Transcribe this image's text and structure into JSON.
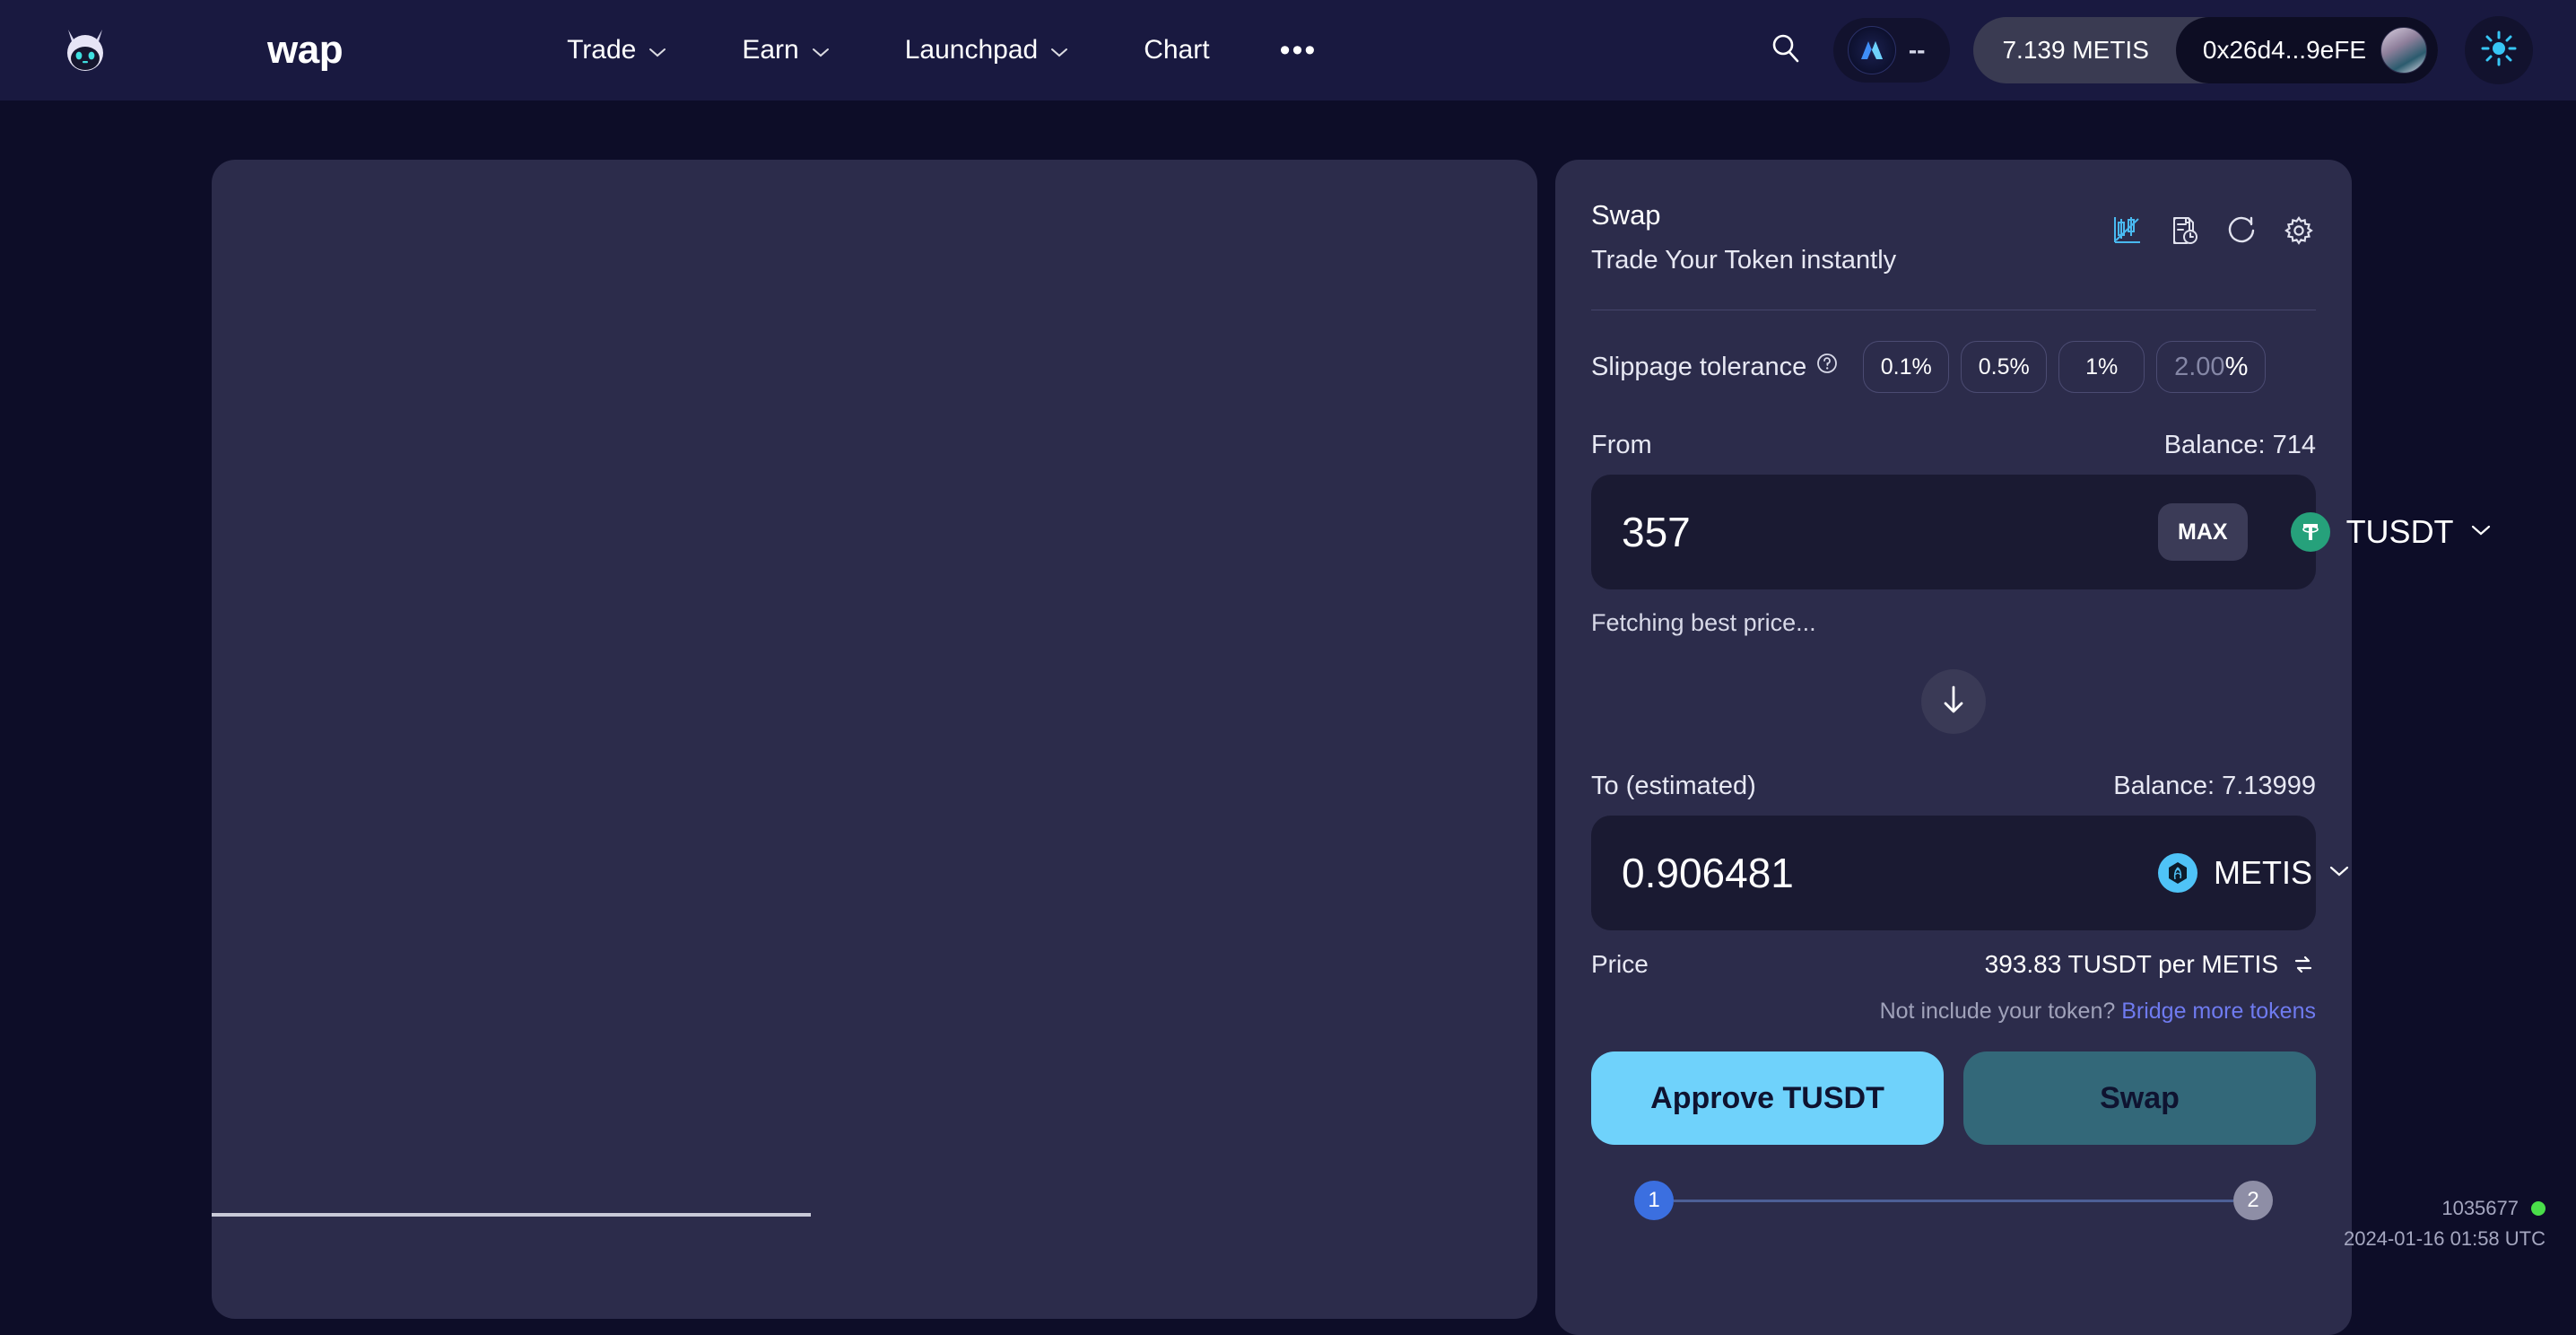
{
  "header": {
    "brand_wordmark": "wap",
    "brand_icon": "cat-head-logo",
    "nav": [
      {
        "label": "Trade",
        "has_dropdown": true
      },
      {
        "label": "Earn",
        "has_dropdown": true
      },
      {
        "label": "Launchpad",
        "has_dropdown": true
      },
      {
        "label": "Chart",
        "has_dropdown": false
      }
    ],
    "more_label": "•••",
    "search_icon": "search-icon",
    "network_value": "--",
    "network_icon": "metis-network-icon",
    "wallet_balance": "7.139 METIS",
    "wallet_address": "0x26d4...9eFE",
    "theme_icon": "sun-icon"
  },
  "swap": {
    "title": "Swap",
    "subtitle": "Trade Your Token instantly",
    "icons": [
      {
        "name": "chart-icon",
        "active": true
      },
      {
        "name": "document-clock-icon",
        "active": false
      },
      {
        "name": "history-clock-icon",
        "active": false
      },
      {
        "name": "gear-icon",
        "active": false
      }
    ],
    "slippage": {
      "label": "Slippage tolerance",
      "help_icon": "question-mark-icon",
      "presets": [
        "0.1%",
        "0.5%",
        "1%"
      ],
      "custom_placeholder": "2.00",
      "custom_suffix": "%"
    },
    "from": {
      "label": "From",
      "balance": "Balance: 714",
      "amount": "357",
      "max_label": "MAX",
      "token_symbol": "TUSDT",
      "token_icon": "tether-icon"
    },
    "fetching_status": "Fetching best price...",
    "switch_icon": "arrow-down-icon",
    "to": {
      "label": "To (estimated)",
      "balance": "Balance: 7.13999",
      "amount": "0.906481",
      "token_symbol": "METIS",
      "token_icon": "metis-icon"
    },
    "price": {
      "label": "Price",
      "value": "393.83 TUSDT per METIS",
      "toggle_icon": "swap-direction-icon"
    },
    "bridge": {
      "prompt": "Not include your token?",
      "link_label": "Bridge more tokens"
    },
    "actions": {
      "approve_label": "Approve TUSDT",
      "swap_label": "Swap"
    },
    "stepper": {
      "steps": [
        "1",
        "2"
      ],
      "active_index": 0
    }
  },
  "status": {
    "block_number": "1035677",
    "timestamp": "2024-01-16 01:58 UTC",
    "indicator": "online-dot"
  },
  "colors": {
    "page_bg": "#0d0d28",
    "header_bg": "#191940",
    "panel_bg": "#2c2c4b",
    "input_bg": "#1a1a32",
    "accent_cyan": "#6fd2fb",
    "accent_teal": "#336879",
    "accent_blue": "#3b6fe0",
    "link_purple": "#6f7bf0",
    "usdt_green": "#26a17b",
    "metis_cyan": "#4fc3f7",
    "status_green": "#4ade4a"
  },
  "chart_data": {
    "type": "line",
    "title": "",
    "series": [],
    "x": [],
    "values": [],
    "xlabel": "",
    "ylabel": "",
    "grid": false,
    "empty": true,
    "axis_color": "#c9cad8"
  }
}
